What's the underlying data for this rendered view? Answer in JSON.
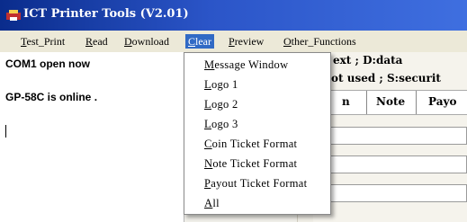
{
  "window": {
    "title": "ICT Printer Tools (V2.01)"
  },
  "menubar": {
    "items": [
      {
        "first": "T",
        "rest": "est_Print"
      },
      {
        "first": "R",
        "rest": "ead"
      },
      {
        "first": "D",
        "rest": "ownload"
      },
      {
        "first": "C",
        "rest": "lear"
      },
      {
        "first": "P",
        "rest": "review"
      },
      {
        "first": "O",
        "rest": "ther_Functions"
      }
    ]
  },
  "log": {
    "line1": "COM1  open now",
    "line2": "GP-58C is online ."
  },
  "right": {
    "line1": "ext ; D:data",
    "line2": "ot used ; S:securit",
    "col1": "n",
    "col2": "Note",
    "col3": "Payo"
  },
  "clear_menu": {
    "items": [
      {
        "first": "M",
        "rest": "essage  Window"
      },
      {
        "first": "L",
        "rest": "ogo  1"
      },
      {
        "first": "L",
        "rest": "ogo  2"
      },
      {
        "first": "L",
        "rest": "ogo  3"
      },
      {
        "first": "C",
        "rest": "oin  Ticket  Format"
      },
      {
        "first": "N",
        "rest": "ote  Ticket  Format"
      },
      {
        "first": "P",
        "rest": "ayout  Ticket  Format"
      },
      {
        "first": "A",
        "rest": "ll"
      }
    ]
  },
  "colors": {
    "title_start": "#0a2c8c",
    "title_end": "#3f6fe0",
    "menu_highlight": "#316ac5"
  },
  "icons": {
    "app": "printer-app-icon"
  }
}
